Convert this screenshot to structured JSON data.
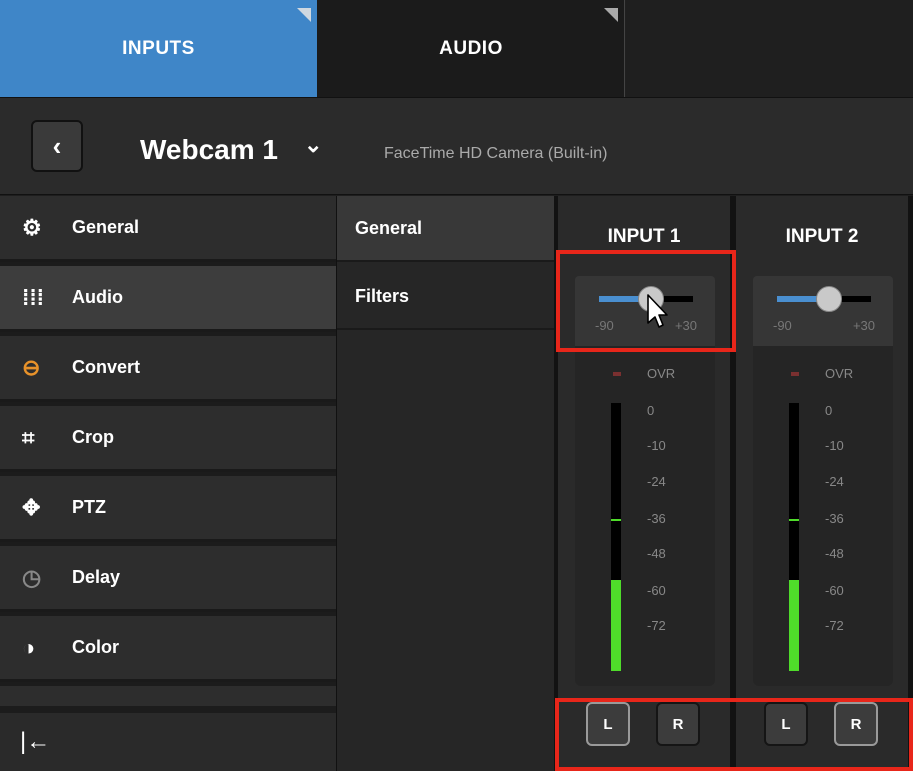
{
  "tabs": [
    {
      "label": "INPUTS",
      "active": true
    },
    {
      "label": "AUDIO",
      "active": false
    }
  ],
  "header": {
    "back_glyph": "‹",
    "source_name": "Webcam 1",
    "source_chevron": "⌄",
    "source_description": "FaceTime HD Camera (Built-in)"
  },
  "sidebar": {
    "items": [
      {
        "label": "General",
        "icon": "gear-icon",
        "glyph": "⚙",
        "active": false
      },
      {
        "label": "Audio",
        "icon": "audio-sliders-icon",
        "glyph": "⁞⁞⁞",
        "active": true
      },
      {
        "label": "Convert",
        "icon": "convert-icon",
        "glyph": "⊖",
        "active": false
      },
      {
        "label": "Crop",
        "icon": "crop-icon",
        "glyph": "⌗",
        "active": false
      },
      {
        "label": "PTZ",
        "icon": "ptz-icon",
        "glyph": "✥",
        "active": false
      },
      {
        "label": "Delay",
        "icon": "clock-icon",
        "glyph": "◷",
        "active": false
      },
      {
        "label": "Color",
        "icon": "color-drop-icon",
        "glyph": "◑",
        "active": false
      }
    ],
    "collapse_glyph": "|←"
  },
  "subnav": {
    "items": [
      {
        "label": "General",
        "active": true
      },
      {
        "label": "Filters",
        "active": false
      }
    ]
  },
  "strips": [
    {
      "title": "INPUT 1",
      "volume_level": 0.55,
      "vol_min": "-90",
      "vol_max": "+30",
      "ovr": "OVR",
      "ticks": [
        "0",
        "-10",
        "-24",
        "-36",
        "-48",
        "-60",
        "-72"
      ],
      "meter_level": 0.34,
      "peak_level": 0.56,
      "left": "L",
      "right": "R",
      "left_on": true,
      "right_on": false
    },
    {
      "title": "INPUT 2",
      "volume_level": 0.55,
      "vol_min": "-90",
      "vol_max": "+30",
      "ovr": "OVR",
      "ticks": [
        "0",
        "-10",
        "-24",
        "-36",
        "-48",
        "-60",
        "-72"
      ],
      "meter_level": 0.34,
      "peak_level": 0.56,
      "left": "L",
      "right": "R",
      "left_on": false,
      "right_on": true
    }
  ],
  "colors": {
    "accent": "#3f86c8",
    "meter_green": "#4fdc2a",
    "volume_blue": "#4a8fd0",
    "highlight_red": "#e8261a"
  }
}
